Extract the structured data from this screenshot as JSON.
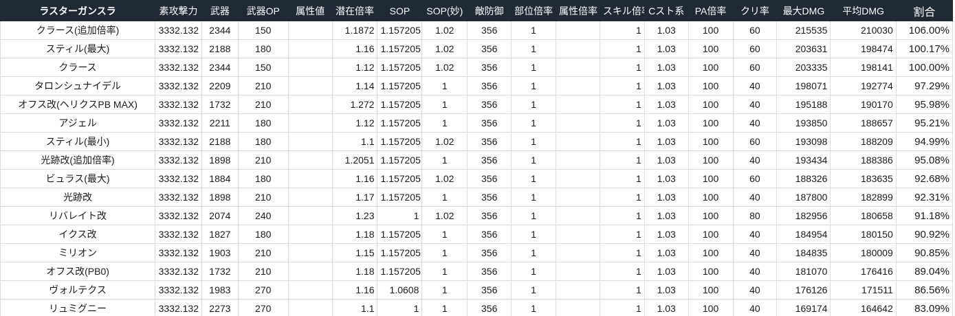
{
  "headers": [
    "ラスターガンスラ",
    "素攻撃力",
    "武器",
    "武器OP",
    "属性値",
    "潜在倍率",
    "SOP",
    "SOP(妙)",
    "敵防御",
    "部位倍率",
    "属性倍率",
    "スキル倍率",
    "Cスト系",
    "PA倍率",
    "クリ率",
    "最大DMG",
    "平均DMG",
    "割合"
  ],
  "rows": [
    [
      "クラース(追加倍率)",
      "3332.132",
      "2344",
      "150",
      "",
      "1.1872",
      "1.157205",
      "1.02",
      "356",
      "1",
      "",
      "1",
      "1.03",
      "100",
      "60",
      "215535",
      "210030",
      "106.00%"
    ],
    [
      "スティル(最大)",
      "3332.132",
      "2188",
      "180",
      "",
      "1.16",
      "1.157205",
      "1.02",
      "356",
      "1",
      "",
      "1",
      "1.03",
      "100",
      "60",
      "203631",
      "198474",
      "100.17%"
    ],
    [
      "クラース",
      "3332.132",
      "2344",
      "150",
      "",
      "1.12",
      "1.157205",
      "1.02",
      "356",
      "1",
      "",
      "1",
      "1.03",
      "100",
      "60",
      "203335",
      "198141",
      "100.00%"
    ],
    [
      "タロンシュナイデル",
      "3332.132",
      "2209",
      "210",
      "",
      "1.14",
      "1.157205",
      "1",
      "356",
      "1",
      "",
      "1",
      "1.03",
      "100",
      "40",
      "198071",
      "192774",
      "97.29%"
    ],
    [
      "オフス改(ヘリクスPB MAX)",
      "3332.132",
      "1732",
      "210",
      "",
      "1.272",
      "1.157205",
      "1",
      "356",
      "1",
      "",
      "1",
      "1.03",
      "100",
      "40",
      "195188",
      "190170",
      "95.98%"
    ],
    [
      "アジェル",
      "3332.132",
      "2211",
      "180",
      "",
      "1.12",
      "1.157205",
      "1",
      "356",
      "1",
      "",
      "1",
      "1.03",
      "100",
      "40",
      "193850",
      "188657",
      "95.21%"
    ],
    [
      "スティル(最小)",
      "3332.132",
      "2188",
      "180",
      "",
      "1.1",
      "1.157205",
      "1.02",
      "356",
      "1",
      "",
      "1",
      "1.03",
      "100",
      "60",
      "193098",
      "188209",
      "94.99%"
    ],
    [
      "光跡改(追加倍率)",
      "3332.132",
      "1898",
      "210",
      "",
      "1.2051",
      "1.157205",
      "1",
      "356",
      "1",
      "",
      "1",
      "1.03",
      "100",
      "40",
      "193434",
      "188386",
      "95.08%"
    ],
    [
      "ビュラス(最大)",
      "3332.132",
      "1884",
      "180",
      "",
      "1.16",
      "1.157205",
      "1.02",
      "356",
      "1",
      "",
      "1",
      "1.03",
      "100",
      "60",
      "188326",
      "183635",
      "92.68%"
    ],
    [
      "光跡改",
      "3332.132",
      "1898",
      "210",
      "",
      "1.17",
      "1.157205",
      "1",
      "356",
      "1",
      "",
      "1",
      "1.03",
      "100",
      "40",
      "187800",
      "182899",
      "92.31%"
    ],
    [
      "リバレイト改",
      "3332.132",
      "2074",
      "240",
      "",
      "1.23",
      "1",
      "1.02",
      "356",
      "1",
      "",
      "1",
      "1.03",
      "100",
      "80",
      "182956",
      "180658",
      "91.18%"
    ],
    [
      "イクス改",
      "3332.132",
      "1827",
      "180",
      "",
      "1.18",
      "1.157205",
      "1",
      "356",
      "1",
      "",
      "1",
      "1.03",
      "100",
      "40",
      "184954",
      "180150",
      "90.92%"
    ],
    [
      "ミリオン",
      "3332.132",
      "1903",
      "210",
      "",
      "1.15",
      "1.157205",
      "1",
      "356",
      "1",
      "",
      "1",
      "1.03",
      "100",
      "40",
      "184835",
      "180009",
      "90.85%"
    ],
    [
      "オフス改(PB0)",
      "3332.132",
      "1732",
      "210",
      "",
      "1.18",
      "1.157205",
      "1",
      "356",
      "1",
      "",
      "1",
      "1.03",
      "100",
      "40",
      "181070",
      "176416",
      "89.04%"
    ],
    [
      "ヴォルテクス",
      "3332.132",
      "1983",
      "270",
      "",
      "1.16",
      "1.0608",
      "1",
      "356",
      "1",
      "",
      "1",
      "1.03",
      "100",
      "40",
      "176126",
      "171511",
      "86.56%"
    ],
    [
      "リュミグニー",
      "3332.132",
      "2273",
      "270",
      "",
      "1.1",
      "1",
      "1",
      "356",
      "1",
      "",
      "1",
      "1.03",
      "100",
      "40",
      "169174",
      "164642",
      "83.09%"
    ]
  ],
  "colors": {
    "header_bg": "#202a34",
    "header_text": "#ffffff",
    "grid": "#dcdcdc"
  }
}
